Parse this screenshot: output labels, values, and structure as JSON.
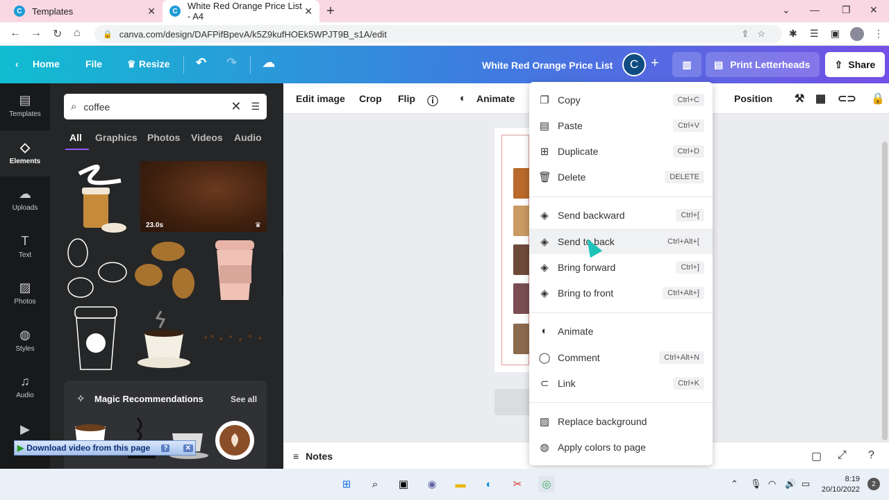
{
  "browser": {
    "tabs": [
      {
        "title": "Templates",
        "active": false
      },
      {
        "title": "White Red Orange Price List - A4",
        "active": true
      }
    ],
    "url": "canva.com/design/DAFPifBpevA/k5Z9kufHOEk5WPJT9B_s1A/edit"
  },
  "header": {
    "home": "Home",
    "file": "File",
    "resize": "Resize",
    "doc_title": "White Red Orange Price List",
    "avatar_initial": "C",
    "print": "Print Letterheads",
    "share": "Share"
  },
  "rail": {
    "items": [
      {
        "label": "Templates",
        "icon": "template-icon"
      },
      {
        "label": "Elements",
        "icon": "elements-icon"
      },
      {
        "label": "Uploads",
        "icon": "upload-cloud-icon"
      },
      {
        "label": "Text",
        "icon": "text-icon"
      },
      {
        "label": "Photos",
        "icon": "photo-icon"
      },
      {
        "label": "Styles",
        "icon": "palette-icon"
      },
      {
        "label": "Audio",
        "icon": "music-icon"
      }
    ]
  },
  "panel": {
    "search_value": "coffee",
    "tabs": [
      "All",
      "Graphics",
      "Photos",
      "Videos",
      "Audio"
    ],
    "video_duration": "23.0s",
    "magic_title": "Magic Recommendations",
    "see_all": "See all",
    "download_bar": "Download video from this page"
  },
  "toolbar": {
    "edit_image": "Edit image",
    "crop": "Crop",
    "flip": "Flip",
    "animate": "Animate",
    "position": "Position"
  },
  "bottom": {
    "notes": "Notes"
  },
  "context_menu": {
    "groups": [
      [
        {
          "label": "Copy",
          "shortcut": "Ctrl+C",
          "icon": "copy-icon"
        },
        {
          "label": "Paste",
          "shortcut": "Ctrl+V",
          "icon": "paste-icon"
        },
        {
          "label": "Duplicate",
          "shortcut": "Ctrl+D",
          "icon": "duplicate-icon"
        },
        {
          "label": "Delete",
          "shortcut": "DELETE",
          "icon": "trash-icon"
        }
      ],
      [
        {
          "label": "Send backward",
          "shortcut": "Ctrl+[",
          "icon": "send-backward-icon"
        },
        {
          "label": "Send to back",
          "shortcut": "Ctrl+Alt+[",
          "icon": "send-to-back-icon"
        },
        {
          "label": "Bring forward",
          "shortcut": "Ctrl+]",
          "icon": "bring-forward-icon"
        },
        {
          "label": "Bring to front",
          "shortcut": "Ctrl+Alt+]",
          "icon": "bring-to-front-icon"
        }
      ],
      [
        {
          "label": "Animate",
          "shortcut": "",
          "icon": "animate-icon"
        },
        {
          "label": "Comment",
          "shortcut": "Ctrl+Alt+N",
          "icon": "comment-icon"
        },
        {
          "label": "Link",
          "shortcut": "Ctrl+K",
          "icon": "link-icon"
        }
      ],
      [
        {
          "label": "Replace background",
          "shortcut": "",
          "icon": "replace-background-icon"
        },
        {
          "label": "Apply colors to page",
          "shortcut": "",
          "icon": "palette-icon"
        }
      ]
    ]
  },
  "taskbar": {
    "time": "8:19",
    "date": "20/10/2022",
    "notifications": "2"
  },
  "colors": {
    "header_gradient_start": "#11bdd1",
    "header_gradient_end": "#7550e6",
    "panel_bg": "#252627",
    "rail_bg": "#18191b",
    "accent": "#8b5cf6"
  }
}
